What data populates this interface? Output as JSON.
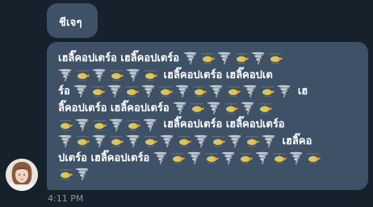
{
  "messages": [
    {
      "text": "ชีเจๆ"
    },
    {
      "lines": [
        [
          {
            "t": "text",
            "v": "เฮลิ๊คอปเตร์อ เฮลิ๊คอปเตร์อ "
          },
          {
            "t": "tornado"
          },
          {
            "t": "helicopter"
          },
          {
            "t": "tornado"
          },
          {
            "t": "helicopter"
          },
          {
            "t": "tornado"
          },
          {
            "t": "helicopter"
          }
        ],
        [
          {
            "t": "tornado"
          },
          {
            "t": "helicopter"
          },
          {
            "t": "tornado"
          },
          {
            "t": "helicopter"
          },
          {
            "t": "tornado"
          },
          {
            "t": "helicopter"
          },
          {
            "t": "text",
            "v": " เฮลิ๊คอปเตร์อ เฮลิ๊คอปเต"
          }
        ],
        [
          {
            "t": "text",
            "v": "ร์อ "
          },
          {
            "t": "tornado"
          },
          {
            "t": "helicopter"
          },
          {
            "t": "tornado"
          },
          {
            "t": "helicopter"
          },
          {
            "t": "tornado"
          },
          {
            "t": "helicopter"
          },
          {
            "t": "tornado"
          },
          {
            "t": "helicopter"
          },
          {
            "t": "tornado"
          },
          {
            "t": "helicopter"
          },
          {
            "t": "tornado"
          },
          {
            "t": "helicopter"
          },
          {
            "t": "tornado"
          },
          {
            "t": "text",
            "v": " เฮ"
          }
        ],
        [
          {
            "t": "text",
            "v": "ลิ๊คอปเตร์อ เฮลิ๊คอปเตร์อ "
          },
          {
            "t": "tornado"
          },
          {
            "t": "helicopter"
          },
          {
            "t": "tornado"
          },
          {
            "t": "helicopter"
          },
          {
            "t": "tornado"
          },
          {
            "t": "helicopter"
          }
        ],
        [
          {
            "t": "helicopter"
          },
          {
            "t": "tornado"
          },
          {
            "t": "helicopter"
          },
          {
            "t": "tornado"
          },
          {
            "t": "helicopter"
          },
          {
            "t": "tornado"
          },
          {
            "t": "text",
            "v": " เฮลิ๊คอปเตร์อ เฮลิ๊คอปเตร์อ"
          }
        ],
        [
          {
            "t": "tornado"
          },
          {
            "t": "helicopter"
          },
          {
            "t": "tornado"
          },
          {
            "t": "helicopter"
          },
          {
            "t": "tornado"
          },
          {
            "t": "helicopter"
          },
          {
            "t": "tornado"
          },
          {
            "t": "helicopter"
          },
          {
            "t": "tornado"
          },
          {
            "t": "helicopter"
          },
          {
            "t": "tornado"
          },
          {
            "t": "helicopter"
          },
          {
            "t": "tornado"
          },
          {
            "t": "text",
            "v": " เฮลิ๊คอ"
          }
        ],
        [
          {
            "t": "text",
            "v": "ปเตร์อ เฮลิ๊คอปเตร์อ "
          },
          {
            "t": "tornado"
          },
          {
            "t": "helicopter"
          },
          {
            "t": "tornado"
          },
          {
            "t": "helicopter"
          },
          {
            "t": "tornado"
          },
          {
            "t": "helicopter"
          },
          {
            "t": "tornado"
          },
          {
            "t": "helicopter"
          },
          {
            "t": "tornado"
          },
          {
            "t": "helicopter"
          }
        ],
        [
          {
            "t": "helicopter"
          },
          {
            "t": "tornado"
          }
        ]
      ]
    }
  ],
  "time": "4:11 PM",
  "colors": {
    "background": "#17212b",
    "bubble": "#3e5166",
    "time": "#8a98a6"
  },
  "icons": {
    "tornado": "tornado-icon",
    "helicopter": "helicopter-icon",
    "avatar": "avatar"
  }
}
